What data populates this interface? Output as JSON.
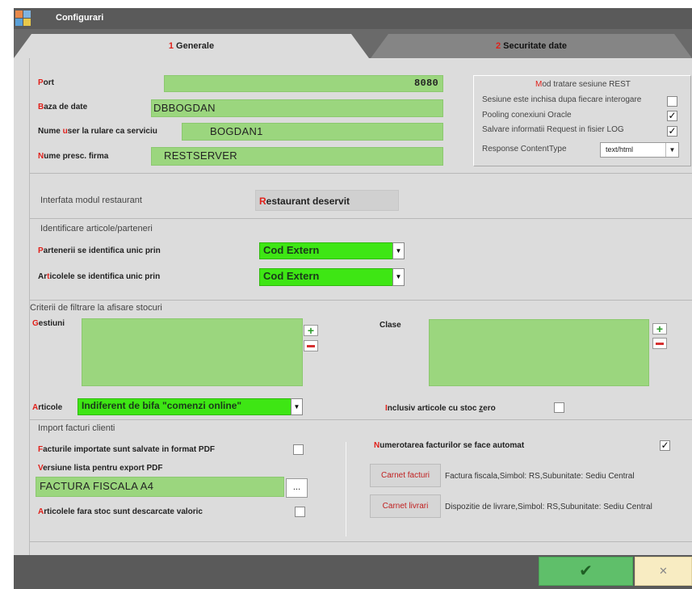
{
  "window": {
    "title": "Configurari"
  },
  "tabs": [
    {
      "num": "1",
      "label": "Generale",
      "active": true
    },
    {
      "num": "2",
      "label": "Securitate date",
      "active": false
    }
  ],
  "connection": {
    "port": {
      "hot": "P",
      "rest": "ort",
      "value": "8080"
    },
    "db": {
      "hot": "B",
      "rest": "aza de date",
      "value": "DBBOGDAN"
    },
    "user": {
      "pre": "Nume ",
      "hot": "u",
      "rest": "ser la rulare ca serviciu",
      "value": "BOGDAN1"
    },
    "firm": {
      "hot": "N",
      "rest": "ume presc. firma",
      "value": "RESTSERVER"
    }
  },
  "rest_session": {
    "title_hot": "M",
    "title_rest": "od tratare sesiune REST",
    "closed_label": "Sesiune este inchisa dupa fiecare interogare",
    "closed_checked": false,
    "pooling_label": "Pooling conexiuni Oracle",
    "pooling_checked": true,
    "log_label": "Salvare informatii Request in fisier LOG",
    "log_checked": true,
    "content_type_label": "Response ContentType",
    "content_type_value": "text/html"
  },
  "restaurant": {
    "label": "Interfata modul restaurant",
    "btn_hot": "R",
    "btn_rest": "estaurant deservit"
  },
  "identify": {
    "title": "Identificare articole/parteneri",
    "partners": {
      "hot": "P",
      "rest": "artenerii se identifica unic prin",
      "value": "Cod Extern"
    },
    "articles": {
      "pre": "Ar",
      "hot": "t",
      "rest": "icolele se identifica unic prin",
      "value": "Cod Extern"
    }
  },
  "filter": {
    "title": "Criterii de filtrare la afisare stocuri",
    "gestiuni_hot": "G",
    "gestiuni_rest": "estiuni",
    "clase": "Clase",
    "articole_hot": "A",
    "articole_rest": "rticole",
    "articole_value": "Indiferent de bifa \"comenzi online\"",
    "zero_hot": "I",
    "zero_rest": "nclusiv articole cu stoc ",
    "zero_u": "z",
    "zero_tail": "ero",
    "zero_checked": false
  },
  "import": {
    "title": "Import facturi clienti",
    "pdf_hot": "F",
    "pdf_rest": "acturile importate sunt salvate in format PDF",
    "pdf_checked": false,
    "version_hot": "V",
    "version_rest": "ersiune lista pentru export PDF",
    "version_value": "FACTURA FISCALA A4",
    "browse": "...",
    "nostock_hot": "A",
    "nostock_rest": "rticolele fara stoc sunt descarcate valoric",
    "nostock_checked": false,
    "auto_hot": "N",
    "auto_rest": "umerotarea facturilor se face automat",
    "auto_checked": true,
    "carnet_facturi_btn": "Carnet facturi",
    "carnet_facturi_text": "Factura fiscala,Simbol: RS,Subunitate: Sediu Central",
    "carnet_livrari_btn": "Carnet livrari",
    "carnet_livrari_text": "Dispozitie de livrare,Simbol: RS,Subunitate: Sediu Central"
  },
  "footer": {
    "ok": "✔",
    "cancel": "✕"
  },
  "colors": {
    "field_green": "#9bd67e",
    "dropdown_green": "#3ee614",
    "hotkey_red": "#e0201a"
  }
}
